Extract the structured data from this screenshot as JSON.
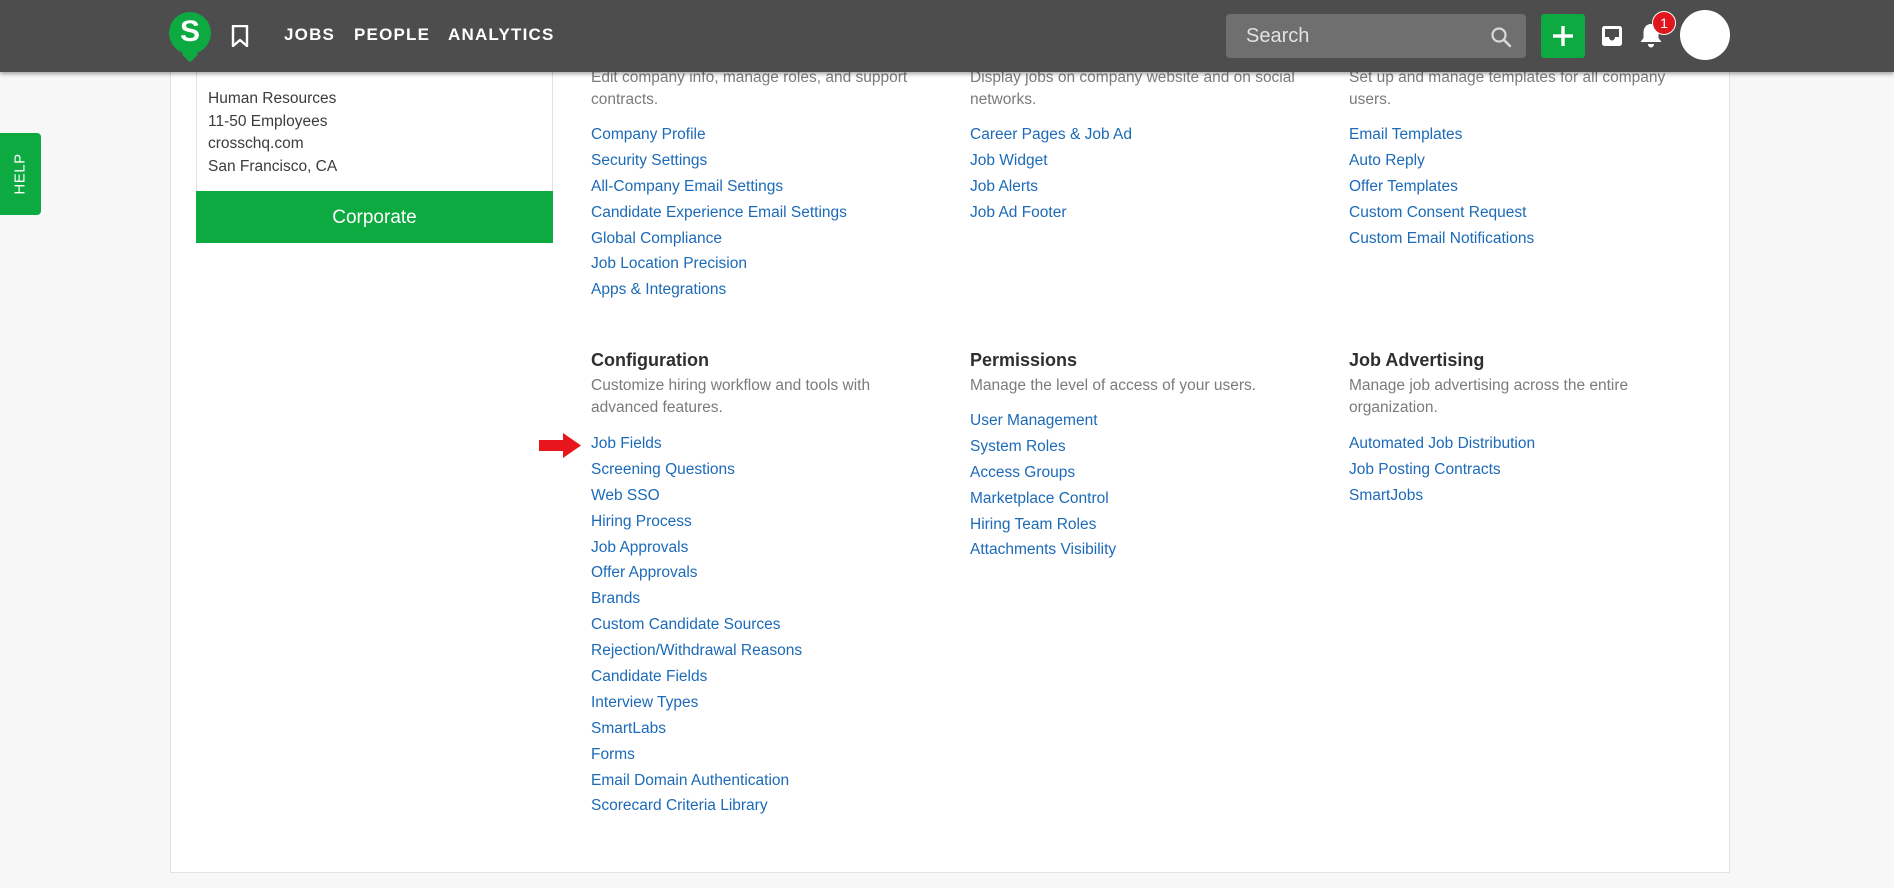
{
  "topbar": {
    "logo_letter": "S",
    "nav": [
      "JOBS",
      "PEOPLE",
      "ANALYTICS"
    ],
    "search_placeholder": "Search",
    "notification_count": "1"
  },
  "help_label": "HELP",
  "company": {
    "lines": [
      "Human Resources",
      "11-50 Employees",
      "crosschq.com",
      "San Francisco, CA"
    ],
    "button_label": "Corporate"
  },
  "sections": {
    "company_top": {
      "desc": "Edit company info, manage roles, and support contracts.",
      "links": [
        "Company Profile",
        "Security Settings",
        "All-Company Email Settings",
        "Candidate Experience Email Settings",
        "Global Compliance",
        "Job Location Precision",
        "Apps & Integrations"
      ]
    },
    "career_top": {
      "desc": "Display jobs on company website and on social networks.",
      "links": [
        "Career Pages & Job Ad",
        "Job Widget",
        "Job Alerts",
        "Job Ad Footer"
      ]
    },
    "templates_top": {
      "desc": "Set up and manage templates for all company users.",
      "links": [
        "Email Templates",
        "Auto Reply",
        "Offer Templates",
        "Custom Consent Request",
        "Custom Email Notifications"
      ]
    },
    "configuration": {
      "title": "Configuration",
      "desc": "Customize hiring workflow and tools with advanced features.",
      "links": [
        "Job Fields",
        "Screening Questions",
        "Web SSO",
        "Hiring Process",
        "Job Approvals",
        "Offer Approvals",
        "Brands",
        "Custom Candidate Sources",
        "Rejection/Withdrawal Reasons",
        "Candidate Fields",
        "Interview Types",
        "SmartLabs",
        "Forms",
        "Email Domain Authentication",
        "Scorecard Criteria Library"
      ]
    },
    "permissions": {
      "title": "Permissions",
      "desc": "Manage the level of access of your users.",
      "links": [
        "User Management",
        "System Roles",
        "Access Groups",
        "Marketplace Control",
        "Hiring Team Roles",
        "Attachments Visibility"
      ]
    },
    "job_advertising": {
      "title": "Job Advertising",
      "desc": "Manage job advertising across the entire organization.",
      "links": [
        "Automated Job Distribution",
        "Job Posting Contracts",
        "SmartJobs"
      ]
    }
  },
  "colors": {
    "topbar": "#4d4d4d",
    "brand_green": "#0caa41",
    "link_blue": "#1c6ab8",
    "badge_red": "#e0151e",
    "arrow_red": "#e8161c"
  }
}
